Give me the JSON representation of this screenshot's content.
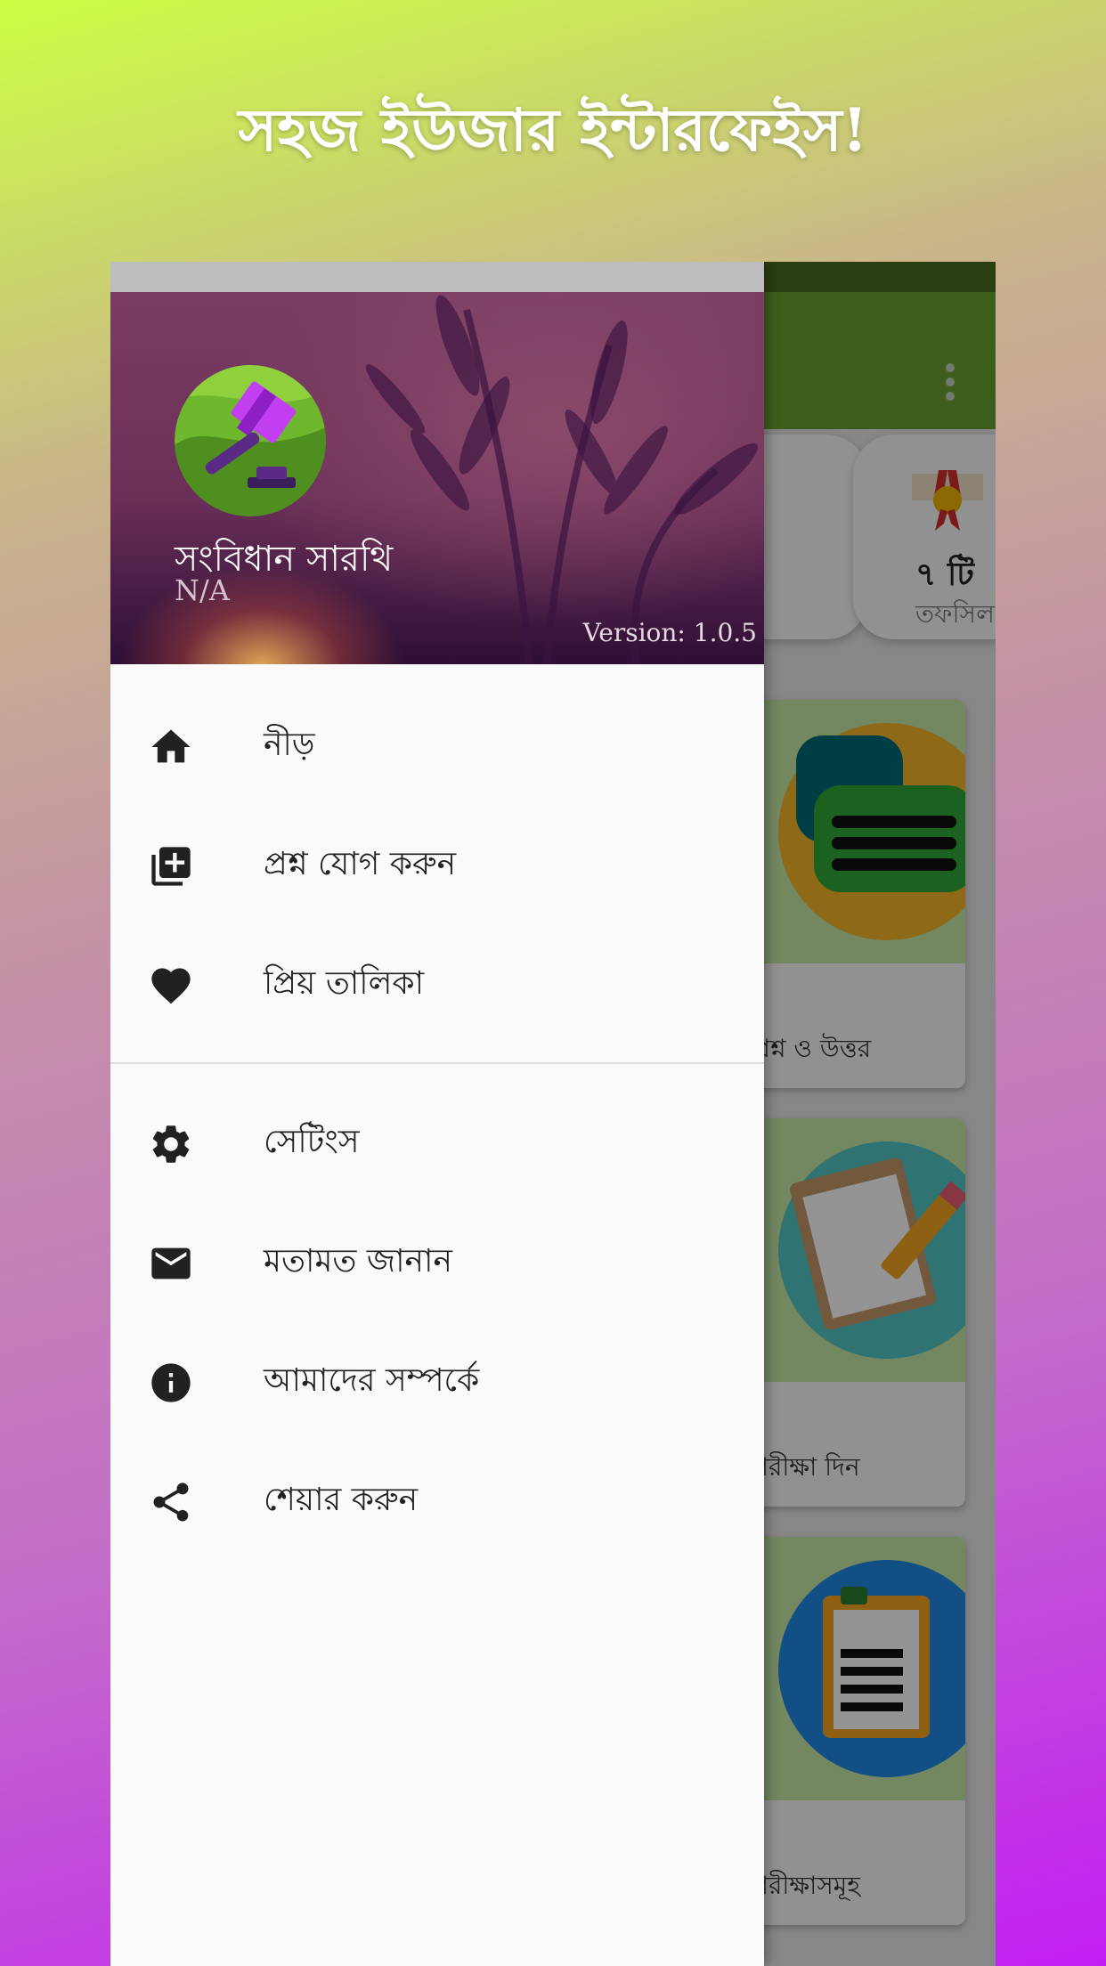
{
  "promo": {
    "title": "সহজ ইউজার ইন্টারফেইস!"
  },
  "background_app": {
    "stats": [
      {
        "count": "",
        "label": ""
      },
      {
        "count": "৭ টি",
        "label": "তফসিল"
      }
    ],
    "cards": [
      {
        "label": "প্রশ্ন ও উত্তর",
        "icon": "chat-icon"
      },
      {
        "label": "পরীক্ষা দিন",
        "icon": "clipboard-pencil-icon"
      },
      {
        "label": "পরীক্ষাসমূহ",
        "icon": "clipboard-list-icon"
      }
    ],
    "colors": {
      "toolbar": "#6aa031",
      "status": "#4a6b1e"
    }
  },
  "drawer": {
    "header": {
      "app_name": "সংবিধান সারথি",
      "user": "N/A",
      "version": "Version: 1.0.5",
      "logo_icon": "gavel-icon"
    },
    "items": [
      {
        "label": "নীড়",
        "icon": "home-icon"
      },
      {
        "label": "প্রশ্ন যোগ করুন",
        "icon": "add-box-icon"
      },
      {
        "label": "প্রিয় তালিকা",
        "icon": "heart-icon"
      },
      {
        "label": "সেটিংস",
        "icon": "gear-icon"
      },
      {
        "label": "মতামত জানান",
        "icon": "mail-icon"
      },
      {
        "label": "আমাদের সম্পর্কে",
        "icon": "info-icon"
      },
      {
        "label": "শেয়ার করুন",
        "icon": "share-icon"
      }
    ]
  }
}
